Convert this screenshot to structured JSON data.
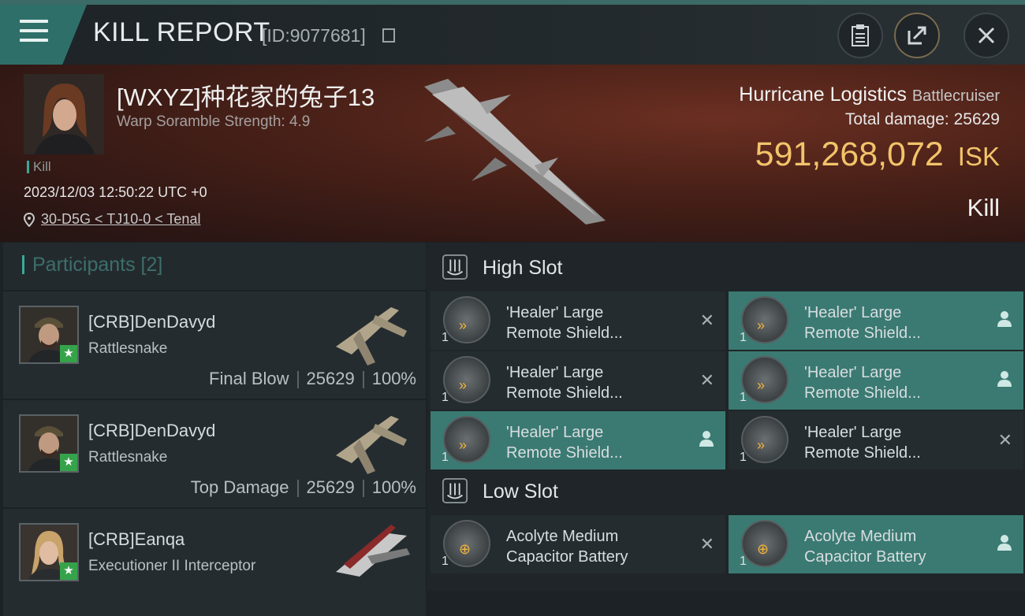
{
  "header": {
    "title": "KILL REPORT",
    "kill_id": "[ID:9077681]"
  },
  "victim": {
    "name": "[WXYZ]种花家的兔子13",
    "warp_scramble": "Warp Soramble Strength: 4.9",
    "tag": "Kill",
    "datetime": "2023/12/03 12:50:22 UTC +0",
    "location": "30-D5G < TJ10-0 < Tenal",
    "ship_name": "Hurricane Logistics",
    "ship_class": "Battlecruiser",
    "total_damage_label": "Total damage:",
    "total_damage_value": "25629",
    "isk_value": "591,268,072",
    "isk_unit": "ISK",
    "result": "Kill"
  },
  "participants": {
    "header": "Participants [2]",
    "rows": [
      {
        "name": "[CRB]DenDavyd",
        "ship": "Rattlesnake",
        "role": "Final Blow",
        "damage": "25629",
        "percent": "100%"
      },
      {
        "name": "[CRB]DenDavyd",
        "ship": "Rattlesnake",
        "role": "Top Damage",
        "damage": "25629",
        "percent": "100%"
      },
      {
        "name": "[CRB]Eanqa",
        "ship": "Executioner II Interceptor",
        "role": "",
        "damage": "",
        "percent": ""
      }
    ]
  },
  "slots": {
    "high": {
      "label": "High Slot",
      "modules": [
        {
          "line1": "'Healer' Large",
          "line2": "Remote Shield...",
          "count": "1",
          "status": "✕",
          "status_icon": "destroyed-icon"
        },
        {
          "line1": "'Healer' Large",
          "line2": "Remote Shield...",
          "count": "1",
          "status": "",
          "status_icon": "dropped-person-icon"
        },
        {
          "line1": "'Healer' Large",
          "line2": "Remote Shield...",
          "count": "1",
          "status": "✕",
          "status_icon": "destroyed-icon"
        },
        {
          "line1": "'Healer' Large",
          "line2": "Remote Shield...",
          "count": "1",
          "status": "",
          "status_icon": "dropped-person-icon"
        },
        {
          "line1": "'Healer' Large",
          "line2": "Remote Shield...",
          "count": "1",
          "status": "",
          "status_icon": "dropped-person-icon"
        },
        {
          "line1": "'Healer' Large",
          "line2": "Remote Shield...",
          "count": "1",
          "status": "✕",
          "status_icon": "destroyed-icon"
        }
      ]
    },
    "low": {
      "label": "Low Slot",
      "modules": [
        {
          "line1": "Acolyte Medium",
          "line2": "Capacitor Battery",
          "count": "1",
          "status": "✕",
          "status_icon": "destroyed-icon"
        },
        {
          "line1": "Acolyte Medium",
          "line2": "Capacitor Battery",
          "count": "1",
          "status": "",
          "status_icon": "dropped-person-icon"
        }
      ]
    }
  },
  "colors": {
    "accent_teal": "#3ca898",
    "isk_gold": "#f2c46a",
    "star_green": "#35a34a"
  }
}
